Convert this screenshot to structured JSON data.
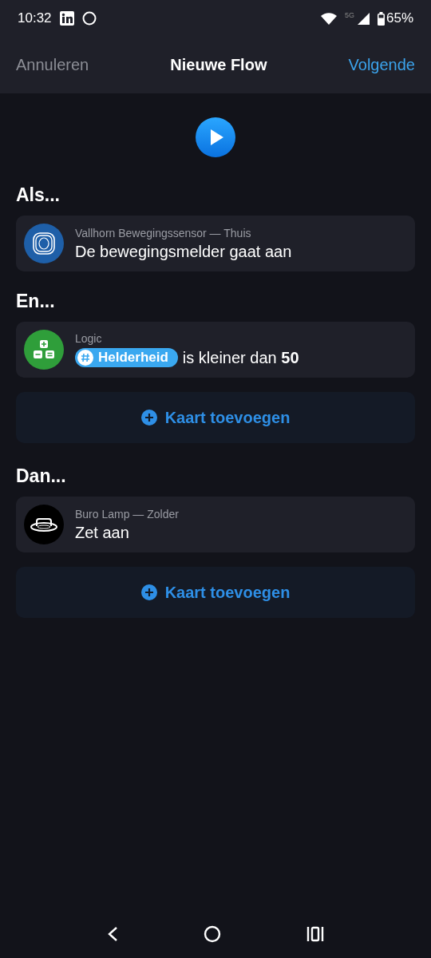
{
  "status_bar": {
    "time": "10:32",
    "network": "5G",
    "battery": "65%"
  },
  "header": {
    "cancel": "Annuleren",
    "title": "Nieuwe Flow",
    "next": "Volgende"
  },
  "sections": [
    {
      "title": "Als...",
      "cards": [
        {
          "kind": "sensor",
          "color": "#1e5fa8",
          "subtitle": "Vallhorn Bewegingssensor — Thuis",
          "text": "De bewegingsmelder gaat aan"
        }
      ]
    },
    {
      "title": "En...",
      "cards": [
        {
          "kind": "logic",
          "color": "#2f9e3a",
          "subtitle": "Logic",
          "token": "Helderheid",
          "text": "is kleiner dan **50**"
        }
      ],
      "add_button": "Kaart toevoegen"
    },
    {
      "title": "Dan...",
      "cards": [
        {
          "kind": "lamp",
          "color": "#000000",
          "subtitle": "Buro Lamp — Zolder",
          "text": "Zet aan"
        }
      ],
      "add_button": "Kaart toevoegen"
    }
  ]
}
